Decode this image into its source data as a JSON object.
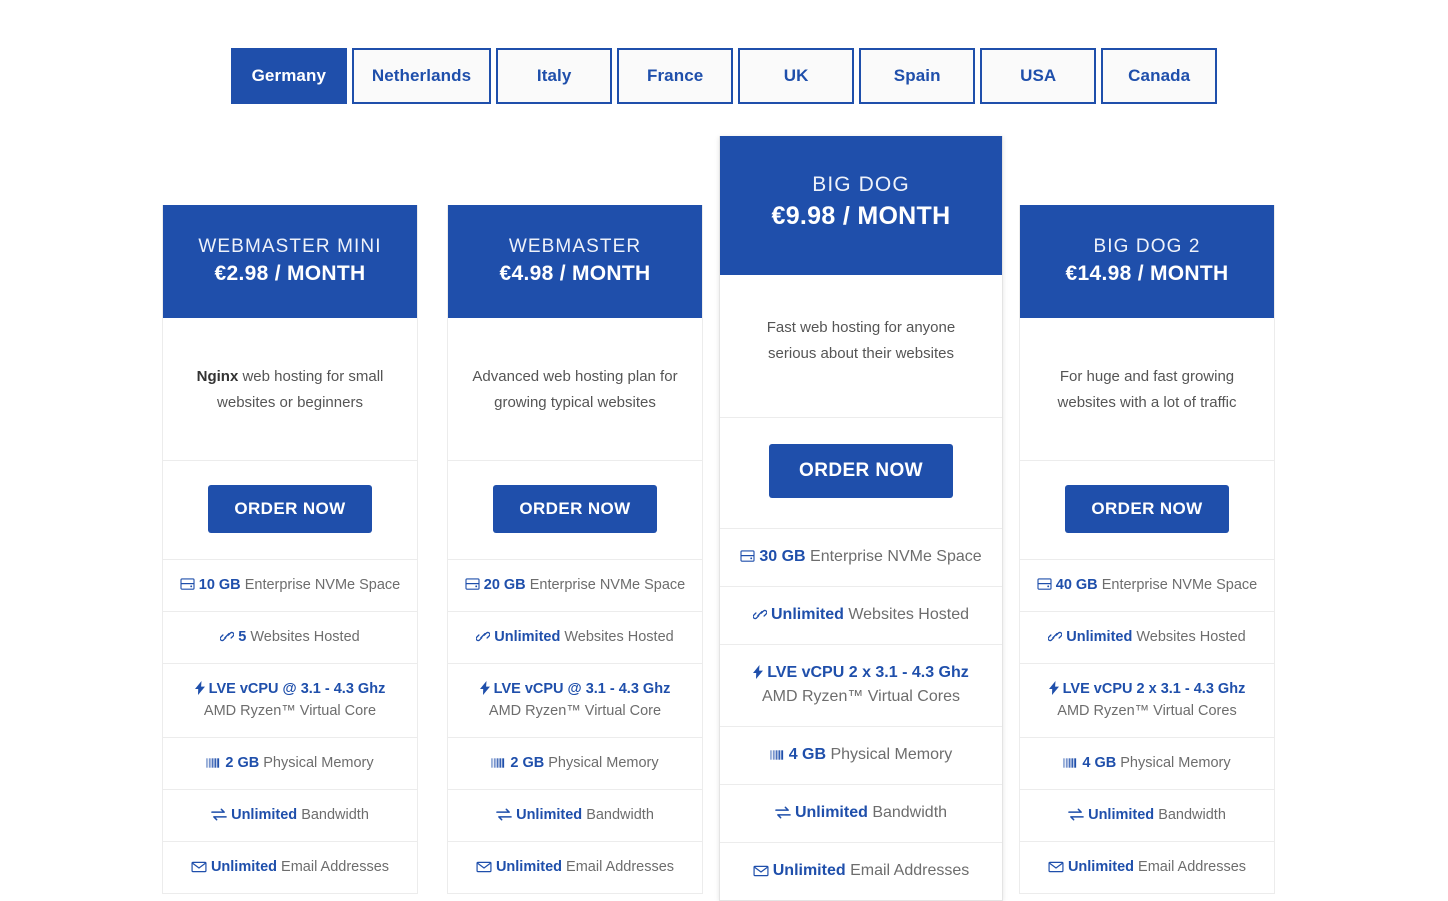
{
  "colors": {
    "brand": "#1f4fab",
    "border": "#ececec",
    "text": "#6d6d6d"
  },
  "tabs": {
    "items": [
      {
        "label": "Germany",
        "active": true
      },
      {
        "label": "Netherlands",
        "active": false
      },
      {
        "label": "Italy",
        "active": false
      },
      {
        "label": "France",
        "active": false
      },
      {
        "label": "UK",
        "active": false
      },
      {
        "label": "Spain",
        "active": false
      },
      {
        "label": "USA",
        "active": false
      },
      {
        "label": "Canada",
        "active": false
      }
    ]
  },
  "plans": [
    {
      "name": "WEBMASTER MINI",
      "price": "€2.98 / MONTH",
      "desc_bold": "Nginx",
      "desc_rest": " web hosting for small websites or beginners",
      "cta": "ORDER NOW",
      "featured": false,
      "features": [
        {
          "icon": "hdd-icon",
          "hi": "10 GB",
          "rest": "Enterprise NVMe Space",
          "sub": ""
        },
        {
          "icon": "link-icon",
          "hi": "5",
          "rest": "Websites Hosted",
          "sub": ""
        },
        {
          "icon": "bolt-icon",
          "hi": "LVE vCPU @ 3.1 - 4.3 Ghz",
          "rest": "",
          "sub": "AMD Ryzen™ Virtual Core"
        },
        {
          "icon": "memory-icon",
          "hi": "2 GB",
          "rest": "Physical Memory",
          "sub": ""
        },
        {
          "icon": "exchange-icon",
          "hi": "Unlimited",
          "rest": "Bandwidth",
          "sub": ""
        },
        {
          "icon": "envelope-icon",
          "hi": "Unlimited",
          "rest": "Email Addresses",
          "sub": ""
        }
      ]
    },
    {
      "name": "WEBMASTER",
      "price": "€4.98 / MONTH",
      "desc_bold": "",
      "desc_rest": "Advanced web hosting plan for growing typical websites",
      "cta": "ORDER NOW",
      "featured": false,
      "features": [
        {
          "icon": "hdd-icon",
          "hi": "20 GB",
          "rest": "Enterprise NVMe Space",
          "sub": ""
        },
        {
          "icon": "link-icon",
          "hi": "Unlimited",
          "rest": "Websites Hosted",
          "sub": ""
        },
        {
          "icon": "bolt-icon",
          "hi": "LVE vCPU @ 3.1 - 4.3 Ghz",
          "rest": "",
          "sub": "AMD Ryzen™ Virtual Core"
        },
        {
          "icon": "memory-icon",
          "hi": "2 GB",
          "rest": "Physical Memory",
          "sub": ""
        },
        {
          "icon": "exchange-icon",
          "hi": "Unlimited",
          "rest": "Bandwidth",
          "sub": ""
        },
        {
          "icon": "envelope-icon",
          "hi": "Unlimited",
          "rest": "Email Addresses",
          "sub": ""
        }
      ]
    },
    {
      "name": "BIG DOG",
      "price": "€9.98 / MONTH",
      "desc_bold": "",
      "desc_rest": "Fast web hosting for anyone serious about their websites",
      "cta": "ORDER NOW",
      "featured": true,
      "features": [
        {
          "icon": "hdd-icon",
          "hi": "30 GB",
          "rest": "Enterprise NVMe Space",
          "sub": ""
        },
        {
          "icon": "link-icon",
          "hi": "Unlimited",
          "rest": "Websites Hosted",
          "sub": ""
        },
        {
          "icon": "bolt-icon",
          "hi": "LVE vCPU 2 x 3.1 - 4.3 Ghz",
          "rest": "",
          "sub": "AMD Ryzen™ Virtual Cores"
        },
        {
          "icon": "memory-icon",
          "hi": "4 GB",
          "rest": "Physical Memory",
          "sub": ""
        },
        {
          "icon": "exchange-icon",
          "hi": "Unlimited",
          "rest": "Bandwidth",
          "sub": ""
        },
        {
          "icon": "envelope-icon",
          "hi": "Unlimited",
          "rest": "Email Addresses",
          "sub": ""
        }
      ]
    },
    {
      "name": "BIG DOG 2",
      "price": "€14.98 / MONTH",
      "desc_bold": "",
      "desc_rest": "For huge and fast growing websites with a lot of traffic",
      "cta": "ORDER NOW",
      "featured": false,
      "features": [
        {
          "icon": "hdd-icon",
          "hi": "40 GB",
          "rest": "Enterprise NVMe Space",
          "sub": ""
        },
        {
          "icon": "link-icon",
          "hi": "Unlimited",
          "rest": "Websites Hosted",
          "sub": ""
        },
        {
          "icon": "bolt-icon",
          "hi": "LVE vCPU 2 x 3.1 - 4.3 Ghz",
          "rest": "",
          "sub": "AMD Ryzen™ Virtual Cores"
        },
        {
          "icon": "memory-icon",
          "hi": "4 GB",
          "rest": "Physical Memory",
          "sub": ""
        },
        {
          "icon": "exchange-icon",
          "hi": "Unlimited",
          "rest": "Bandwidth",
          "sub": ""
        },
        {
          "icon": "envelope-icon",
          "hi": "Unlimited",
          "rest": "Email Addresses",
          "sub": ""
        }
      ]
    }
  ]
}
